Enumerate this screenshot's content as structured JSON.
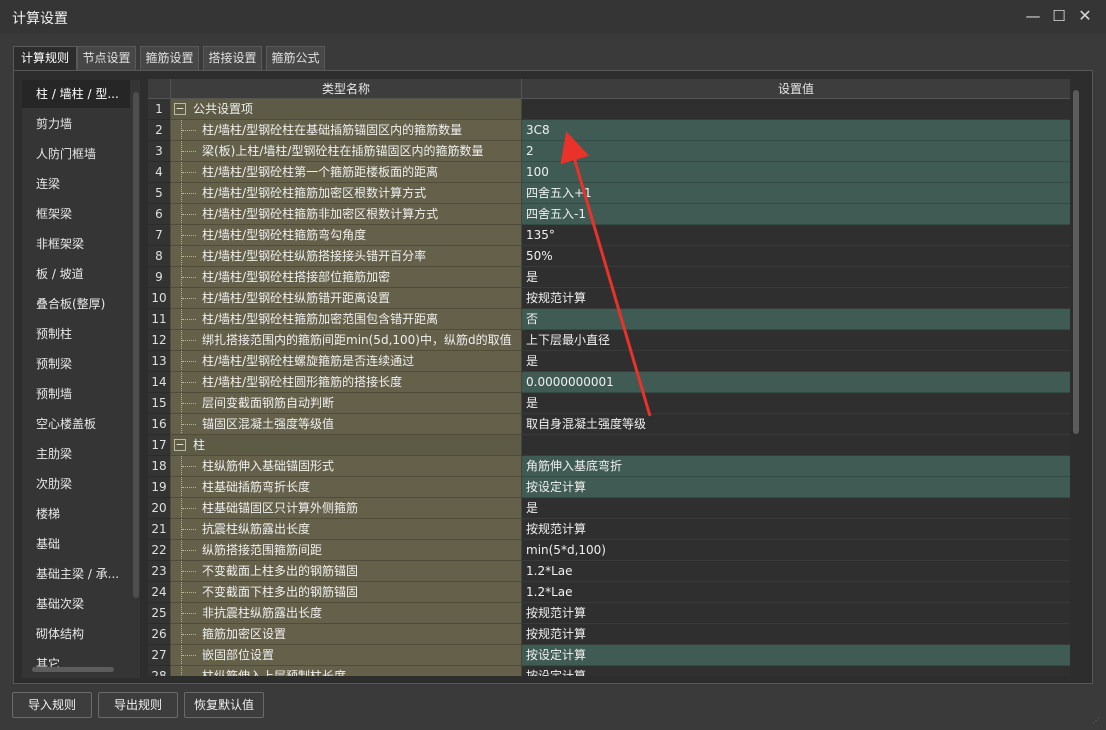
{
  "window": {
    "title": "计算设置",
    "min_label": "—",
    "max_label": "☐",
    "close_label": "✕"
  },
  "tabs": [
    {
      "label": "计算规则",
      "active": true
    },
    {
      "label": "节点设置",
      "active": false
    },
    {
      "label": "箍筋设置",
      "active": false
    },
    {
      "label": "搭接设置",
      "active": false
    },
    {
      "label": "箍筋公式",
      "active": false
    }
  ],
  "sidebar": {
    "items": [
      {
        "label": "柱 / 墙柱 / 型...",
        "active": true
      },
      {
        "label": "剪力墙"
      },
      {
        "label": "人防门框墙"
      },
      {
        "label": "连梁"
      },
      {
        "label": "框架梁"
      },
      {
        "label": "非框架梁"
      },
      {
        "label": "板 / 坡道"
      },
      {
        "label": "叠合板(整厚)"
      },
      {
        "label": "预制柱"
      },
      {
        "label": "预制梁"
      },
      {
        "label": "预制墙"
      },
      {
        "label": "空心楼盖板"
      },
      {
        "label": "主肋梁"
      },
      {
        "label": "次肋梁"
      },
      {
        "label": "楼梯"
      },
      {
        "label": "基础"
      },
      {
        "label": "基础主梁 / 承..."
      },
      {
        "label": "基础次梁"
      },
      {
        "label": "砌体结构"
      },
      {
        "label": "其它"
      }
    ]
  },
  "grid": {
    "headers": {
      "num": "",
      "name": "类型名称",
      "value": "设置值"
    },
    "rows": [
      {
        "num": "1",
        "name": "公共设置项",
        "value": "",
        "group": true,
        "expander": "−"
      },
      {
        "num": "2",
        "name": "柱/墙柱/型钢砼柱在基础插筋锚固区内的箍筋数量",
        "value": "3C8",
        "hl": true
      },
      {
        "num": "3",
        "name": "梁(板)上柱/墙柱/型钢砼柱在插筋锚固区内的箍筋数量",
        "value": "2",
        "hl": true
      },
      {
        "num": "4",
        "name": "柱/墙柱/型钢砼柱第一个箍筋距楼板面的距离",
        "value": "100",
        "hl": true
      },
      {
        "num": "5",
        "name": "柱/墙柱/型钢砼柱箍筋加密区根数计算方式",
        "value": "四舍五入+1",
        "hl": true
      },
      {
        "num": "6",
        "name": "柱/墙柱/型钢砼柱箍筋非加密区根数计算方式",
        "value": "四舍五入-1",
        "hl": true
      },
      {
        "num": "7",
        "name": "柱/墙柱/型钢砼柱箍筋弯勾角度",
        "value": "135°",
        "hl": false
      },
      {
        "num": "8",
        "name": "柱/墙柱/型钢砼柱纵筋搭接接头错开百分率",
        "value": "50%",
        "hl": false
      },
      {
        "num": "9",
        "name": "柱/墙柱/型钢砼柱搭接部位箍筋加密",
        "value": "是",
        "hl": false
      },
      {
        "num": "10",
        "name": "柱/墙柱/型钢砼柱纵筋错开距离设置",
        "value": "按规范计算",
        "hl": false
      },
      {
        "num": "11",
        "name": "柱/墙柱/型钢砼柱箍筋加密范围包含错开距离",
        "value": "否",
        "hl": true
      },
      {
        "num": "12",
        "name": "绑扎搭接范围内的箍筋间距min(5d,100)中，纵筋d的取值",
        "value": "上下层最小直径",
        "hl": false
      },
      {
        "num": "13",
        "name": "柱/墙柱/型钢砼柱螺旋箍筋是否连续通过",
        "value": "是",
        "hl": false
      },
      {
        "num": "14",
        "name": "柱/墙柱/型钢砼柱圆形箍筋的搭接长度",
        "value": "0.0000000001",
        "hl": true
      },
      {
        "num": "15",
        "name": "层间变截面钢筋自动判断",
        "value": "是",
        "hl": false
      },
      {
        "num": "16",
        "name": "锚固区混凝土强度等级值",
        "value": "取自身混凝土强度等级",
        "hl": false
      },
      {
        "num": "17",
        "name": "柱",
        "value": "",
        "group": true,
        "expander": "−"
      },
      {
        "num": "18",
        "name": "柱纵筋伸入基础锚固形式",
        "value": "角筋伸入基底弯折",
        "hl": true
      },
      {
        "num": "19",
        "name": "柱基础插筋弯折长度",
        "value": "按设定计算",
        "hl": true
      },
      {
        "num": "20",
        "name": "柱基础锚固区只计算外侧箍筋",
        "value": "是",
        "hl": false
      },
      {
        "num": "21",
        "name": "抗震柱纵筋露出长度",
        "value": "按规范计算",
        "hl": false
      },
      {
        "num": "22",
        "name": "纵筋搭接范围箍筋间距",
        "value": "min(5*d,100)",
        "hl": false
      },
      {
        "num": "23",
        "name": "不变截面上柱多出的钢筋锚固",
        "value": "1.2*Lae",
        "hl": false
      },
      {
        "num": "24",
        "name": "不变截面下柱多出的钢筋锚固",
        "value": "1.2*Lae",
        "hl": false
      },
      {
        "num": "25",
        "name": "非抗震柱纵筋露出长度",
        "value": "按规范计算",
        "hl": false
      },
      {
        "num": "26",
        "name": "箍筋加密区设置",
        "value": "按规范计算",
        "hl": false
      },
      {
        "num": "27",
        "name": "嵌固部位设置",
        "value": "按设定计算",
        "hl": true
      },
      {
        "num": "28",
        "name": "柱纵筋伸入上层预制柱长度",
        "value": "按设定计算",
        "hl": false
      }
    ]
  },
  "buttons": {
    "import": "导入规则",
    "export": "导出规则",
    "reset": "恢复默认值"
  },
  "colors": {
    "name_cell": "#646049",
    "value_highlight": "#3f5b54",
    "annotation_arrow": "#e8322a"
  }
}
